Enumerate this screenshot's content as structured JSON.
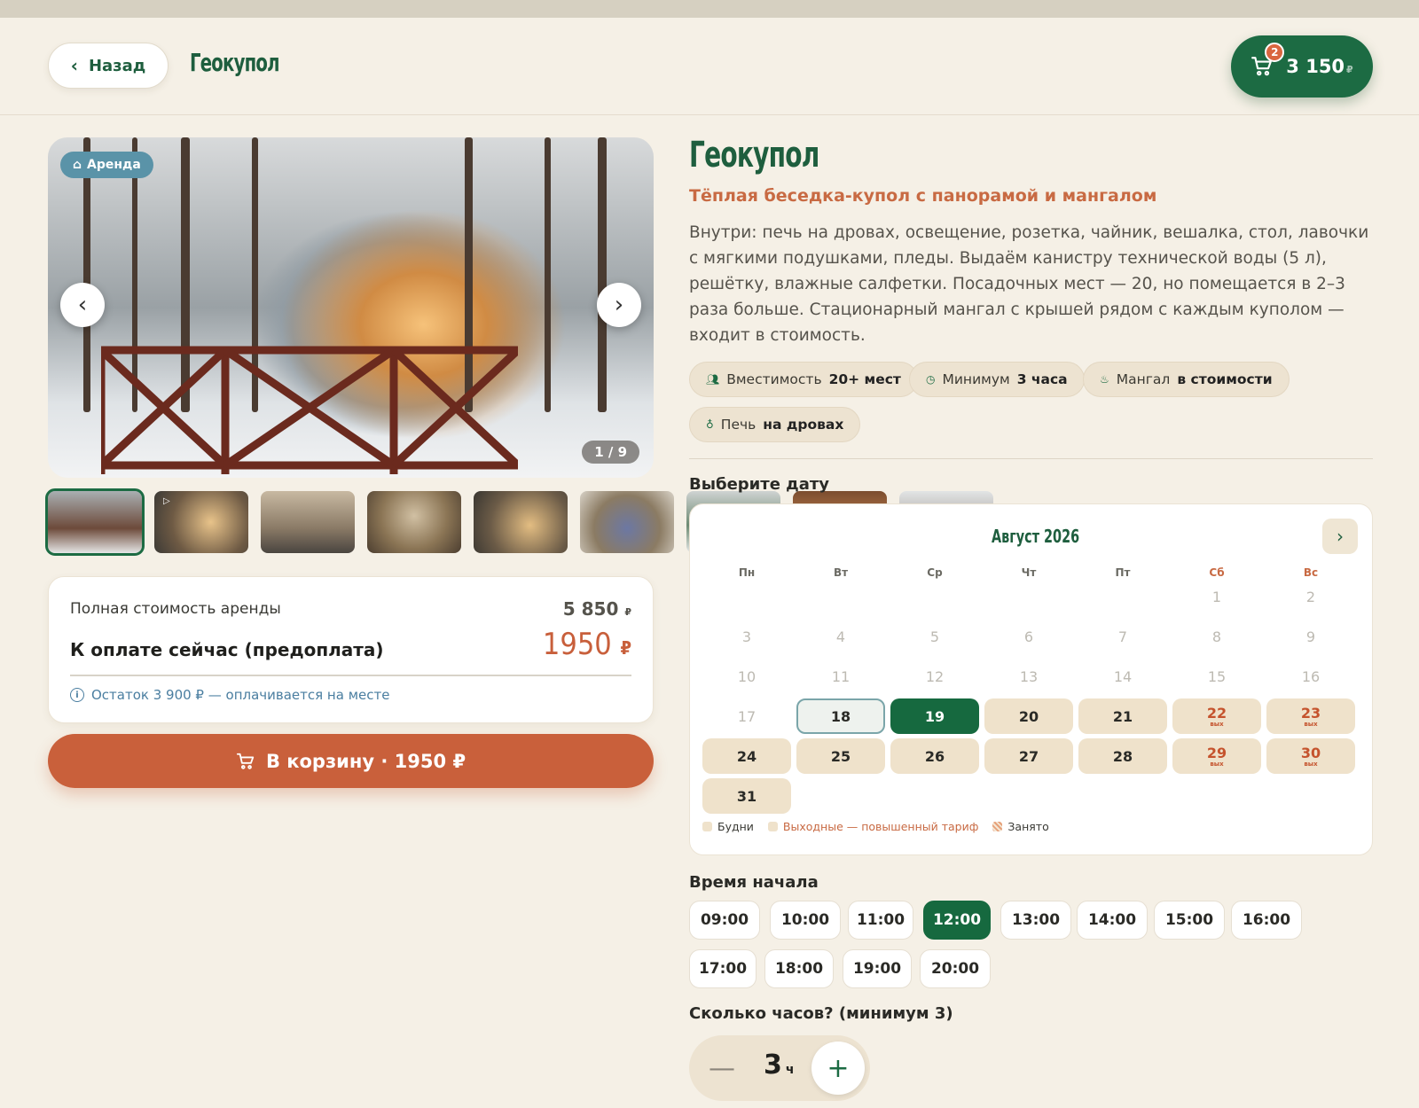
{
  "header": {
    "back_label": "Назад",
    "brand": "Геокупол",
    "cart_count": "2",
    "cart_total": "3 150",
    "cart_currency": "₽"
  },
  "gallery": {
    "badge": "Аренда",
    "counter": "1 / 9",
    "thumb_count": 9
  },
  "price": {
    "full_label": "Полная стоимость аренды",
    "full_value": "5 850",
    "full_currency": "₽",
    "prepay_label": "К оплате сейчас (предоплата)",
    "prepay_value": "1950",
    "prepay_currency": "₽",
    "note": "Остаток 3 900 ₽ — оплачивается на месте"
  },
  "add_to_cart": {
    "label": "В корзину · 1950 ₽"
  },
  "product": {
    "title": "Геокупол",
    "subtitle": "Тёплая беседка-купол с панорамой и мангалом",
    "description": "Внутри: печь на дровах, освещение, розетка, чайник, вешалка, стол, лавочки с мягкими подушками, пледы. Выдаём канистру технической воды (5 л), решётку, влажные салфетки. Посадочных мест — 20, но помещается в 2–3 раза больше. Стационарный мангал с крышей рядом с каждым куполом — входит в стоимость.",
    "chips": [
      {
        "icon": "people-icon",
        "label": "Вместимость",
        "value": "20+ мест"
      },
      {
        "icon": "clock-icon",
        "label": "Минимум",
        "value": "3 часа"
      },
      {
        "icon": "grill-icon",
        "label": "Мангал",
        "value": "в стоимости"
      },
      {
        "icon": "flame-icon",
        "label": "Печь",
        "value": "на дровах"
      }
    ]
  },
  "calendar": {
    "heading": "Выберите дату",
    "month": "Август 2026",
    "weekdays": [
      "Пн",
      "Вт",
      "Ср",
      "Чт",
      "Пт",
      "Сб",
      "Вс"
    ],
    "weekend_mark": "вых",
    "selected_day": 19,
    "today_day": 18,
    "first_available": 18,
    "legend": [
      "Будни",
      "Выходные — повышенный тариф",
      "Занято"
    ]
  },
  "time": {
    "heading": "Время начала",
    "slots": [
      "09:00",
      "10:00",
      "11:00",
      "12:00",
      "13:00",
      "14:00",
      "15:00",
      "16:00",
      "17:00",
      "18:00",
      "19:00",
      "20:00"
    ],
    "selected": "12:00"
  },
  "hours": {
    "heading": "Сколько часов? (минимум 3)",
    "value": "3",
    "unit": "ч"
  },
  "colors": {
    "brand_green": "#1c6b43",
    "accent_orange": "#c9603b",
    "background": "#f5f0e6"
  }
}
